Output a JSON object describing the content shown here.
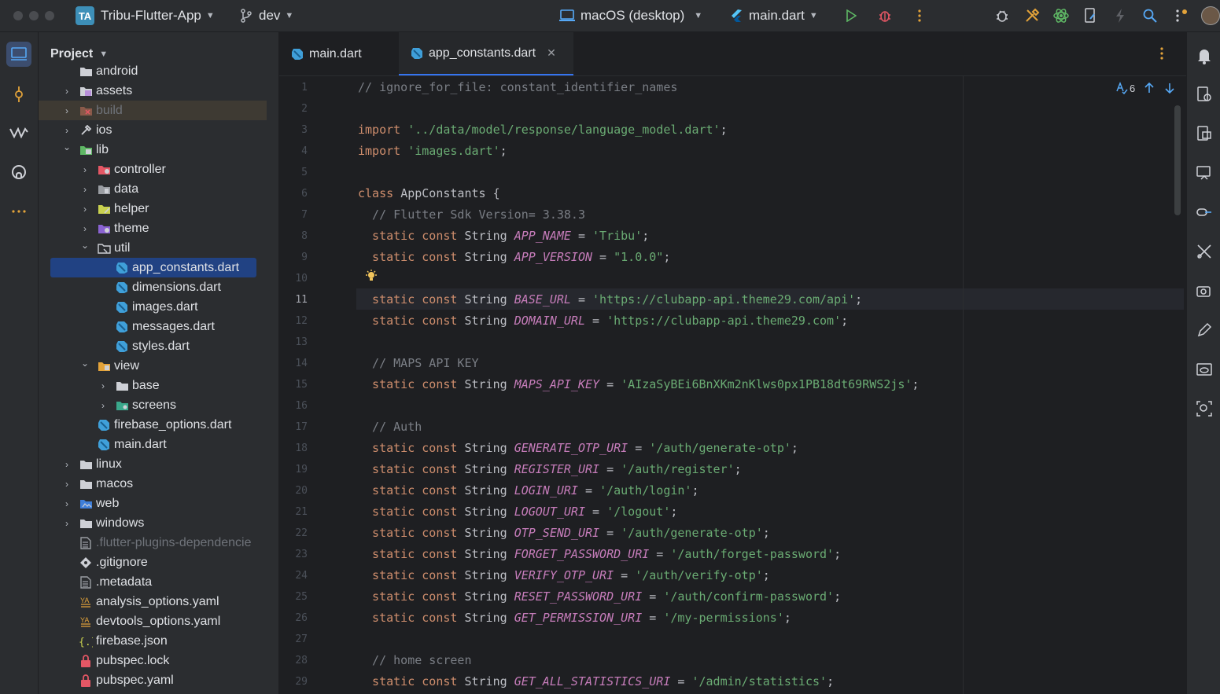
{
  "titlebar": {
    "project_badge": "TA",
    "project_name": "Tribu-Flutter-App",
    "branch": "dev",
    "device": "macOS (desktop)",
    "run_config": "main.dart"
  },
  "project_panel": {
    "title": "Project",
    "tree": [
      {
        "label": "android",
        "level": 1,
        "arrow": "",
        "icon": "folder",
        "dim": false
      },
      {
        "label": "assets",
        "level": 1,
        "arrow": "›",
        "icon": "assets-folder",
        "dim": false
      },
      {
        "label": "build",
        "level": 1,
        "arrow": "›",
        "icon": "excluded-folder",
        "dim": true
      },
      {
        "label": "ios",
        "level": 1,
        "arrow": "›",
        "icon": "ios-folder",
        "dim": false
      },
      {
        "label": "lib",
        "level": 1,
        "arrow": "⌄",
        "icon": "source-folder",
        "dim": false
      },
      {
        "label": "controller",
        "level": 2,
        "arrow": "›",
        "icon": "controller-folder",
        "dim": false
      },
      {
        "label": "data",
        "level": 2,
        "arrow": "›",
        "icon": "data-folder",
        "dim": false
      },
      {
        "label": "helper",
        "level": 2,
        "arrow": "›",
        "icon": "helper-folder",
        "dim": false
      },
      {
        "label": "theme",
        "level": 2,
        "arrow": "›",
        "icon": "theme-folder",
        "dim": false
      },
      {
        "label": "util",
        "level": 2,
        "arrow": "⌄",
        "icon": "util-folder",
        "dim": false
      },
      {
        "label": "app_constants.dart",
        "level": 3,
        "arrow": "",
        "icon": "dart-file",
        "dim": false,
        "selected": true
      },
      {
        "label": "dimensions.dart",
        "level": 3,
        "arrow": "",
        "icon": "dart-file",
        "dim": false
      },
      {
        "label": "images.dart",
        "level": 3,
        "arrow": "",
        "icon": "dart-file",
        "dim": false
      },
      {
        "label": "messages.dart",
        "level": 3,
        "arrow": "",
        "icon": "dart-file",
        "dim": false
      },
      {
        "label": "styles.dart",
        "level": 3,
        "arrow": "",
        "icon": "dart-file",
        "dim": false
      },
      {
        "label": "view",
        "level": 2,
        "arrow": "⌄",
        "icon": "view-folder",
        "dim": false
      },
      {
        "label": "base",
        "level": 3,
        "arrow": "›",
        "icon": "folder",
        "dim": false
      },
      {
        "label": "screens",
        "level": 3,
        "arrow": "›",
        "icon": "screens-folder",
        "dim": false
      },
      {
        "label": "firebase_options.dart",
        "level": 2,
        "arrow": "",
        "icon": "dart-file",
        "dim": false
      },
      {
        "label": "main.dart",
        "level": 2,
        "arrow": "",
        "icon": "dart-file",
        "dim": false
      },
      {
        "label": "linux",
        "level": 1,
        "arrow": "›",
        "icon": "folder",
        "dim": false
      },
      {
        "label": "macos",
        "level": 1,
        "arrow": "›",
        "icon": "folder",
        "dim": false
      },
      {
        "label": "web",
        "level": 1,
        "arrow": "›",
        "icon": "web-folder",
        "dim": false
      },
      {
        "label": "windows",
        "level": 1,
        "arrow": "›",
        "icon": "folder",
        "dim": false
      },
      {
        "label": ".flutter-plugins-dependencie",
        "level": 1,
        "arrow": "",
        "icon": "text-file",
        "dim": true
      },
      {
        "label": ".gitignore",
        "level": 1,
        "arrow": "",
        "icon": "git-file",
        "dim": false
      },
      {
        "label": ".metadata",
        "level": 1,
        "arrow": "",
        "icon": "text-file",
        "dim": false
      },
      {
        "label": "analysis_options.yaml",
        "level": 1,
        "arrow": "",
        "icon": "yaml-file",
        "dim": false
      },
      {
        "label": "devtools_options.yaml",
        "level": 1,
        "arrow": "",
        "icon": "yaml-file",
        "dim": false
      },
      {
        "label": "firebase.json",
        "level": 1,
        "arrow": "",
        "icon": "json-file",
        "dim": false
      },
      {
        "label": "pubspec.lock",
        "level": 1,
        "arrow": "",
        "icon": "lock-file",
        "dim": false
      },
      {
        "label": "pubspec.yaml",
        "level": 1,
        "arrow": "",
        "icon": "lock-file",
        "dim": false
      }
    ]
  },
  "editor": {
    "tabs": [
      {
        "label": "main.dart",
        "active": false
      },
      {
        "label": "app_constants.dart",
        "active": true
      }
    ],
    "inspection_count": "6",
    "current_line": "11",
    "lines": [
      [
        {
          "c": "cmt",
          "t": "// ignore_for_file: constant_identifier_names"
        }
      ],
      [],
      [
        {
          "c": "kw",
          "t": "import "
        },
        {
          "c": "str",
          "t": "'../data/model/response/language_model.dart'"
        },
        {
          "c": "typ",
          "t": ";"
        }
      ],
      [
        {
          "c": "kw",
          "t": "import "
        },
        {
          "c": "str",
          "t": "'images.dart'"
        },
        {
          "c": "typ",
          "t": ";"
        }
      ],
      [],
      [
        {
          "c": "kw",
          "t": "class "
        },
        {
          "c": "typ",
          "t": "AppConstants {"
        }
      ],
      [
        {
          "c": "cmt",
          "t": "  // Flutter Sdk Version= 3.38.3"
        }
      ],
      [
        {
          "c": "kw",
          "t": "  static const "
        },
        {
          "c": "typ",
          "t": "String "
        },
        {
          "c": "const",
          "t": "APP_NAME"
        },
        {
          "c": "typ",
          "t": " = "
        },
        {
          "c": "str",
          "t": "'Tribu'"
        },
        {
          "c": "typ",
          "t": ";"
        }
      ],
      [
        {
          "c": "kw",
          "t": "  static const "
        },
        {
          "c": "typ",
          "t": "String "
        },
        {
          "c": "const",
          "t": "APP_VERSION"
        },
        {
          "c": "typ",
          "t": " = "
        },
        {
          "c": "str",
          "t": "\"1.0.0\""
        },
        {
          "c": "typ",
          "t": ";"
        }
      ],
      [],
      [
        {
          "c": "kw",
          "t": "  static const "
        },
        {
          "c": "typ",
          "t": "String "
        },
        {
          "c": "const",
          "t": "BASE_URL"
        },
        {
          "c": "typ",
          "t": " = "
        },
        {
          "c": "str",
          "t": "'https://clubapp-api.theme29.com/api'"
        },
        {
          "c": "typ",
          "t": ";"
        }
      ],
      [
        {
          "c": "kw",
          "t": "  static const "
        },
        {
          "c": "typ",
          "t": "String "
        },
        {
          "c": "const",
          "t": "DOMAIN_URL"
        },
        {
          "c": "typ",
          "t": " = "
        },
        {
          "c": "str",
          "t": "'https://clubapp-api.theme29.com'"
        },
        {
          "c": "typ",
          "t": ";"
        }
      ],
      [],
      [
        {
          "c": "cmt",
          "t": "  // MAPS API KEY"
        }
      ],
      [
        {
          "c": "kw",
          "t": "  static const "
        },
        {
          "c": "typ",
          "t": "String "
        },
        {
          "c": "const",
          "t": "MAPS_API_KEY"
        },
        {
          "c": "typ",
          "t": " = "
        },
        {
          "c": "str",
          "t": "'AIzaSyBEi6BnXKm2nKlws0px1PB18dt69RWS2js'"
        },
        {
          "c": "typ",
          "t": ";"
        }
      ],
      [],
      [
        {
          "c": "cmt",
          "t": "  // Auth"
        }
      ],
      [
        {
          "c": "kw",
          "t": "  static const "
        },
        {
          "c": "typ",
          "t": "String "
        },
        {
          "c": "const",
          "t": "GENERATE_OTP_URI"
        },
        {
          "c": "typ",
          "t": " = "
        },
        {
          "c": "str",
          "t": "'/auth/generate-otp'"
        },
        {
          "c": "typ",
          "t": ";"
        }
      ],
      [
        {
          "c": "kw",
          "t": "  static const "
        },
        {
          "c": "typ",
          "t": "String "
        },
        {
          "c": "const",
          "t": "REGISTER_URI"
        },
        {
          "c": "typ",
          "t": " = "
        },
        {
          "c": "str",
          "t": "'/auth/register'"
        },
        {
          "c": "typ",
          "t": ";"
        }
      ],
      [
        {
          "c": "kw",
          "t": "  static const "
        },
        {
          "c": "typ",
          "t": "String "
        },
        {
          "c": "const",
          "t": "LOGIN_URI"
        },
        {
          "c": "typ",
          "t": " = "
        },
        {
          "c": "str",
          "t": "'/auth/login'"
        },
        {
          "c": "typ",
          "t": ";"
        }
      ],
      [
        {
          "c": "kw",
          "t": "  static const "
        },
        {
          "c": "typ",
          "t": "String "
        },
        {
          "c": "const",
          "t": "LOGOUT_URI"
        },
        {
          "c": "typ",
          "t": " = "
        },
        {
          "c": "str",
          "t": "'/logout'"
        },
        {
          "c": "typ",
          "t": ";"
        }
      ],
      [
        {
          "c": "kw",
          "t": "  static const "
        },
        {
          "c": "typ",
          "t": "String "
        },
        {
          "c": "const",
          "t": "OTP_SEND_URI"
        },
        {
          "c": "typ",
          "t": " = "
        },
        {
          "c": "str",
          "t": "'/auth/generate-otp'"
        },
        {
          "c": "typ",
          "t": ";"
        }
      ],
      [
        {
          "c": "kw",
          "t": "  static const "
        },
        {
          "c": "typ",
          "t": "String "
        },
        {
          "c": "const",
          "t": "FORGET_PASSWORD_URI"
        },
        {
          "c": "typ",
          "t": " = "
        },
        {
          "c": "str",
          "t": "'/auth/forget-password'"
        },
        {
          "c": "typ",
          "t": ";"
        }
      ],
      [
        {
          "c": "kw",
          "t": "  static const "
        },
        {
          "c": "typ",
          "t": "String "
        },
        {
          "c": "const",
          "t": "VERIFY_OTP_URI"
        },
        {
          "c": "typ",
          "t": " = "
        },
        {
          "c": "str",
          "t": "'/auth/verify-otp'"
        },
        {
          "c": "typ",
          "t": ";"
        }
      ],
      [
        {
          "c": "kw",
          "t": "  static const "
        },
        {
          "c": "typ",
          "t": "String "
        },
        {
          "c": "const",
          "t": "RESET_PASSWORD_URI"
        },
        {
          "c": "typ",
          "t": " = "
        },
        {
          "c": "str",
          "t": "'/auth/confirm-password'"
        },
        {
          "c": "typ",
          "t": ";"
        }
      ],
      [
        {
          "c": "kw",
          "t": "  static const "
        },
        {
          "c": "typ",
          "t": "String "
        },
        {
          "c": "const",
          "t": "GET_PERMISSION_URI"
        },
        {
          "c": "typ",
          "t": " = "
        },
        {
          "c": "str",
          "t": "'/my-permissions'"
        },
        {
          "c": "typ",
          "t": ";"
        }
      ],
      [],
      [
        {
          "c": "cmt",
          "t": "  // home screen"
        }
      ],
      [
        {
          "c": "kw",
          "t": "  static const "
        },
        {
          "c": "typ",
          "t": "String "
        },
        {
          "c": "const",
          "t": "GET_ALL_STATISTICS_URI"
        },
        {
          "c": "typ",
          "t": " = "
        },
        {
          "c": "str",
          "t": "'/admin/statistics'"
        },
        {
          "c": "typ",
          "t": ";"
        }
      ]
    ]
  },
  "colors": {
    "accent": "#3574f0",
    "keyword": "#cf8e6d",
    "string": "#6aab73",
    "constant": "#c77dbb",
    "comment": "#7a7e85"
  }
}
